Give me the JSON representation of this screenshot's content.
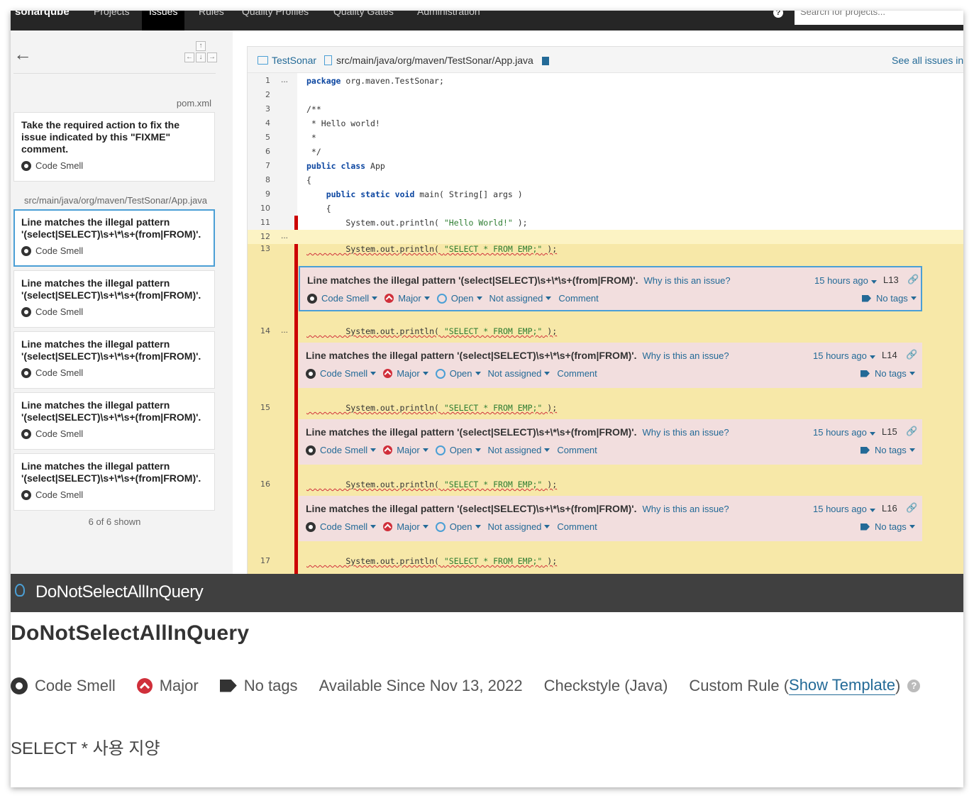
{
  "topnav": {
    "logo": "sonarqube",
    "items": [
      "Projects",
      "Issues",
      "Rules",
      "Quality Profiles",
      "Quality Gates",
      "Administration"
    ],
    "active_index": 1,
    "help": "?",
    "search_placeholder": "Search for projects..."
  },
  "left": {
    "file1": "pom.xml",
    "card1": {
      "message": "Take the required action to fix the issue indicated by this \"FIXME\" comment.",
      "type": "Code Smell"
    },
    "file2": "src/main/java/org/maven/TestSonar/App.java",
    "cards": [
      {
        "message": "Line matches the illegal pattern '(select|SELECT)\\s+\\*\\s+(from|FROM)'.",
        "type": "Code Smell"
      },
      {
        "message": "Line matches the illegal pattern '(select|SELECT)\\s+\\*\\s+(from|FROM)'.",
        "type": "Code Smell"
      },
      {
        "message": "Line matches the illegal pattern '(select|SELECT)\\s+\\*\\s+(from|FROM)'.",
        "type": "Code Smell"
      },
      {
        "message": "Line matches the illegal pattern '(select|SELECT)\\s+\\*\\s+(from|FROM)'.",
        "type": "Code Smell"
      },
      {
        "message": "Line matches the illegal pattern '(select|SELECT)\\s+\\*\\s+(from|FROM)'.",
        "type": "Code Smell"
      }
    ],
    "shown": "6 of 6 shown"
  },
  "viewer": {
    "project": "TestSonar",
    "path": "src/main/java/org/maven/TestSonar/App.java",
    "see_all": "See all issues in",
    "lines": {
      "n1": "1",
      "n2": "2",
      "n3": "3",
      "n4": "4",
      "n5": "5",
      "n6": "6",
      "n7": "7",
      "n8": "8",
      "n9": "9",
      "n10": "10",
      "n11": "11",
      "n12": "12",
      "n13": "13",
      "n14": "14",
      "n15": "15",
      "n16": "16",
      "n17": "17",
      "dots": "...",
      "l1a": "package",
      "l1b": " org.maven.TestSonar;",
      "l3": "/**",
      "l4": " * Hello world!",
      "l5": " *",
      "l6": " */",
      "l7a": "public",
      "l7b": "class",
      "l7c": " App",
      "l8": "{",
      "l9a": "public",
      "l9b": "static",
      "l9c": "void",
      "l9d": " main( String[] args )",
      "l10": "    {",
      "l11a": "        System.out.println( ",
      "l11b": "\"Hello World!\"",
      "l11c": " );",
      "sel_a": "        System.out.println( ",
      "sel_b": "\"SELECT * FROM EMP;\"",
      "sel_c": " );"
    },
    "issue": {
      "message": "Line matches the illegal pattern '(select|SELECT)\\s+\\*\\s+(from|FROM)'.",
      "why": "Why is this an issue?",
      "ago": "15 hours ago",
      "type": "Code Smell",
      "severity": "Major",
      "status": "Open",
      "assignee": "Not assigned",
      "comment": "Comment",
      "tags": "No tags",
      "lines": [
        "L13",
        "L14",
        "L15",
        "L16"
      ]
    }
  },
  "rule": {
    "bar_title": "DoNotSelectAllInQuery",
    "heading": "DoNotSelectAllInQuery",
    "type": "Code Smell",
    "severity": "Major",
    "tags": "No tags",
    "since": "Available Since Nov 13, 2022",
    "repo": "Checkstyle (Java)",
    "custom_prefix": "Custom Rule (",
    "show_template": "Show Template",
    "custom_suffix": ")",
    "help": "?",
    "description": "SELECT * 사용 지양"
  },
  "colors": {
    "accent": "#236a97",
    "issue_bg": "#f2dede",
    "highlight": "#fcf3c4",
    "error_bar": "#cc0000"
  }
}
